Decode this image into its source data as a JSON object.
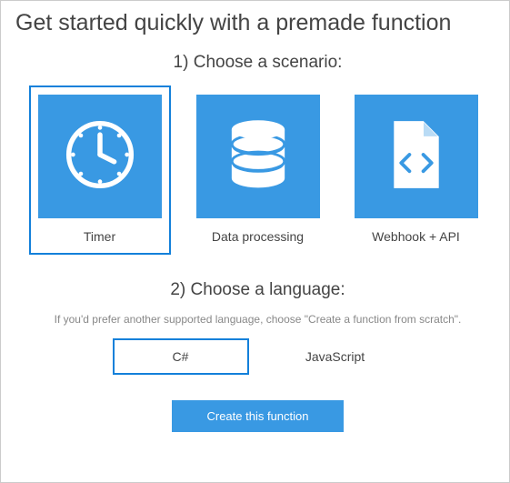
{
  "title": "Get started quickly with a premade function",
  "step1_heading": "1) Choose a scenario:",
  "scenarios": [
    {
      "label": "Timer"
    },
    {
      "label": "Data processing"
    },
    {
      "label": "Webhook + API"
    }
  ],
  "step2_heading": "2) Choose a language:",
  "language_hint": "If you'd prefer another supported language, choose \"Create a function from scratch\".",
  "languages": [
    {
      "label": "C#"
    },
    {
      "label": "JavaScript"
    }
  ],
  "create_button_label": "Create this function"
}
